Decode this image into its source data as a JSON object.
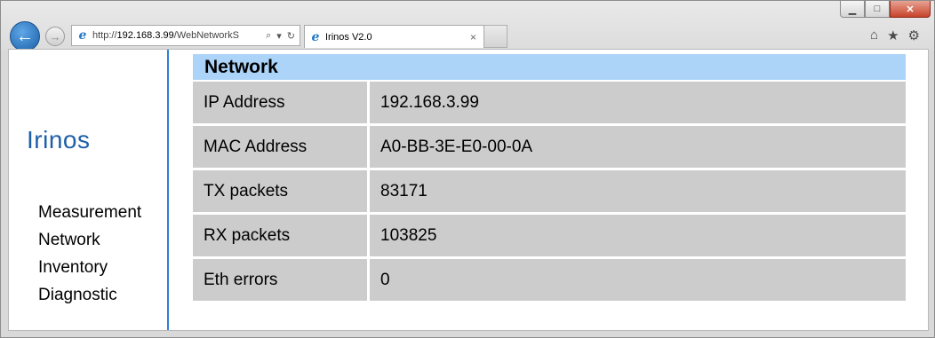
{
  "browser": {
    "address": {
      "prefix": "http://",
      "host": "192.168.3.99",
      "path": "/WebNetworkS",
      "search_icon": "search-icon",
      "dropdown_icon": "chevron-down-icon",
      "refresh_icon": "refresh-icon"
    },
    "tab": {
      "title": "Irinos V2.0",
      "close": "×"
    },
    "window_buttons": {
      "minimize": "▁",
      "maximize": "□",
      "close": "✕"
    },
    "toolbar_icons": [
      "home-icon",
      "star-icon",
      "gear-icon"
    ]
  },
  "sidebar": {
    "logo": "Irinos",
    "items": [
      {
        "label": "Measurement"
      },
      {
        "label": "Network"
      },
      {
        "label": "Inventory"
      },
      {
        "label": "Diagnostic"
      }
    ]
  },
  "main": {
    "title": "Network",
    "rows": [
      {
        "key": "IP Address",
        "value": "192.168.3.99"
      },
      {
        "key": "MAC Address",
        "value": "A0-BB-3E-E0-00-0A"
      },
      {
        "key": "TX packets",
        "value": "83171"
      },
      {
        "key": "RX packets",
        "value": "103825"
      },
      {
        "key": "Eth errors",
        "value": "0"
      }
    ]
  },
  "colors": {
    "accent": "#2d7fd6",
    "header_bg": "#acd4f8",
    "cell_bg": "#cccccc",
    "logo": "#1e5fa8"
  }
}
